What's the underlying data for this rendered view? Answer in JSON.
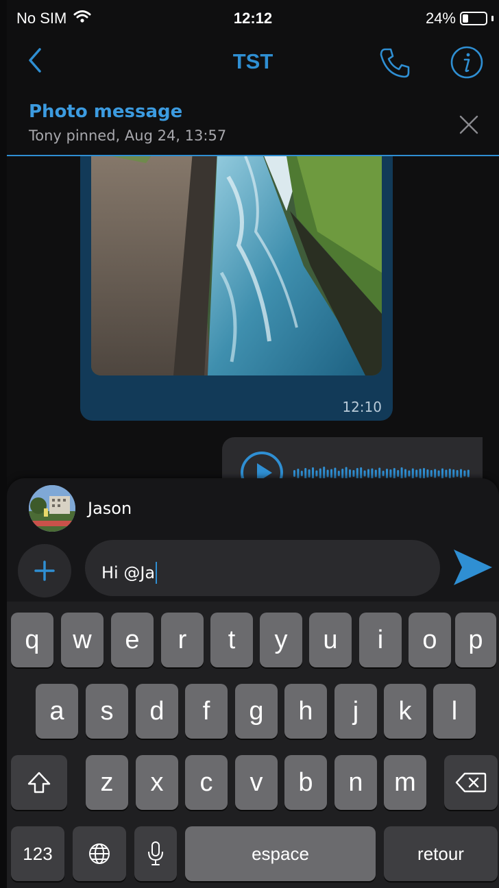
{
  "status_bar": {
    "carrier": "No SIM",
    "time": "12:12",
    "battery_percent": "24%",
    "battery_level": 0.24
  },
  "nav": {
    "title": "TST"
  },
  "pinned": {
    "title": "Photo message",
    "subtitle": "Tony pinned, Aug 24, 13:57"
  },
  "messages": [
    {
      "type": "photo",
      "time": "12:10"
    },
    {
      "type": "voice"
    }
  ],
  "mention_suggestion": {
    "name": "Jason"
  },
  "composer": {
    "text": "Hi @Ja"
  },
  "keyboard": {
    "row1": [
      "q",
      "w",
      "e",
      "r",
      "t",
      "y",
      "u",
      "i",
      "o",
      "p"
    ],
    "row2": [
      "a",
      "s",
      "d",
      "f",
      "g",
      "h",
      "j",
      "k",
      "l"
    ],
    "row3": [
      "z",
      "x",
      "c",
      "v",
      "b",
      "n",
      "m"
    ],
    "numbers_label": "123",
    "space_label": "espace",
    "return_label": "retour"
  },
  "colors": {
    "accent": "#2f8fd3",
    "background": "#0f0f10",
    "key": "#6b6b6e",
    "key_dark": "#3e3e41"
  }
}
